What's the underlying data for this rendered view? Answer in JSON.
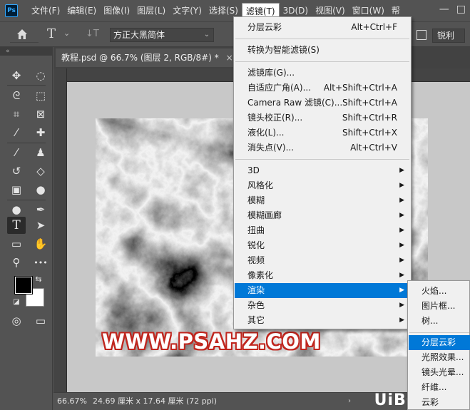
{
  "app": {
    "logo": "Ps"
  },
  "menubar": {
    "items": [
      "文件(F)",
      "编辑(E)",
      "图像(I)",
      "图层(L)",
      "文字(Y)",
      "选择(S)",
      "滤镜(T)",
      "3D(D)",
      "视图(V)",
      "窗口(W)",
      "帮"
    ],
    "active_index": 6,
    "window_controls": {
      "minimize": "—",
      "maximize": "□"
    }
  },
  "options_bar": {
    "home_icon": "home-icon",
    "type_tool_icon": "T",
    "type_dropdown": "⌄",
    "vertical_type_icon": "↓T",
    "font_family": "方正大黑简体",
    "font_dropdown": "⌄",
    "antialias_value": "锐利"
  },
  "panel_collapse": "«",
  "document": {
    "tab_title": "教程.psd @ 66.7% (图层 2, RGB/8#) *",
    "tab_close": "×",
    "watermark": "WWW.PSAHZ.COM"
  },
  "status_bar": {
    "zoom": "66.67%",
    "doc_info": "24.69 厘米 x 17.64 厘米 (72 ppi)",
    "arrow": "›",
    "brand": "UiBQ.CoM"
  },
  "filter_menu": {
    "last_filter": {
      "label": "分层云彩",
      "shortcut": "Alt+Ctrl+F"
    },
    "convert_smart": "转换为智能滤镜(S)",
    "special": [
      {
        "label": "滤镜库(G)...",
        "shortcut": ""
      },
      {
        "label": "自适应广角(A)...",
        "shortcut": "Alt+Shift+Ctrl+A"
      },
      {
        "label": "Camera Raw 滤镜(C)...",
        "shortcut": "Shift+Ctrl+A"
      },
      {
        "label": "镜头校正(R)...",
        "shortcut": "Shift+Ctrl+R"
      },
      {
        "label": "液化(L)...",
        "shortcut": "Shift+Ctrl+X"
      },
      {
        "label": "消失点(V)...",
        "shortcut": "Alt+Ctrl+V"
      }
    ],
    "groups": [
      "3D",
      "风格化",
      "模糊",
      "模糊画廊",
      "扭曲",
      "锐化",
      "视频",
      "像素化",
      "渲染",
      "杂色",
      "其它"
    ],
    "highlighted_group": "渲染",
    "submenu_arrow": "▶"
  },
  "render_submenu": {
    "items": [
      "火焰...",
      "图片框...",
      "树..."
    ],
    "items2": [
      "分层云彩",
      "光照效果...",
      "镜头光晕...",
      "纤维...",
      "云彩"
    ],
    "highlighted": "分层云彩"
  },
  "toolbar": {
    "tools": [
      {
        "name": "move-tool",
        "glyph": "✥"
      },
      {
        "name": "marquee-tool",
        "glyph": "◌"
      },
      {
        "name": "lasso-tool",
        "glyph": "ᘓ"
      },
      {
        "name": "object-select-tool",
        "glyph": "⬚"
      },
      {
        "name": "crop-tool",
        "glyph": "⌗"
      },
      {
        "name": "frame-tool",
        "glyph": "⊠"
      },
      {
        "name": "eyedropper-tool",
        "glyph": "⁄"
      },
      {
        "name": "healing-tool",
        "glyph": "✚"
      },
      {
        "name": "brush-tool",
        "glyph": "⁄"
      },
      {
        "name": "stamp-tool",
        "glyph": "♟"
      },
      {
        "name": "history-brush-tool",
        "glyph": "↺"
      },
      {
        "name": "eraser-tool",
        "glyph": "◇"
      },
      {
        "name": "gradient-tool",
        "glyph": "▣"
      },
      {
        "name": "blur-tool",
        "glyph": "●"
      },
      {
        "name": "dodge-tool",
        "glyph": "●"
      },
      {
        "name": "pen-tool",
        "glyph": "✒"
      },
      {
        "name": "type-tool",
        "glyph": "T"
      },
      {
        "name": "path-select-tool",
        "glyph": "➤"
      },
      {
        "name": "rectangle-tool",
        "glyph": "▭"
      },
      {
        "name": "hand-tool",
        "glyph": "✋"
      },
      {
        "name": "zoom-tool",
        "glyph": "⚲"
      },
      {
        "name": "more-tools",
        "glyph": "•••"
      }
    ],
    "swap_icon": "⇆",
    "default_colors_icon": "◪",
    "quick_mask_icon": "◎",
    "screen_mode_icon": "▭"
  }
}
